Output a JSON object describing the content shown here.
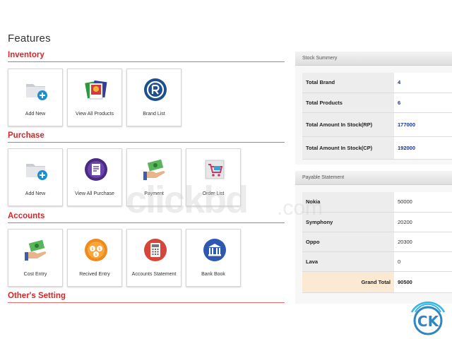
{
  "page": {
    "title": "Features"
  },
  "sections": [
    {
      "title": "Inventory",
      "tiles": [
        {
          "label": "Add New",
          "icon": "folder-add-icon"
        },
        {
          "label": "View All Products",
          "icon": "photos-icon"
        },
        {
          "label": "Brand List",
          "icon": "registered-icon"
        }
      ]
    },
    {
      "title": "Purchase",
      "tiles": [
        {
          "label": "Add New",
          "icon": "folder-add-icon"
        },
        {
          "label": "View All Purchase",
          "icon": "purchase-icon"
        },
        {
          "label": "Payment",
          "icon": "cash-hand-icon"
        },
        {
          "label": "Order List",
          "icon": "cart-icon"
        }
      ]
    },
    {
      "title": "Accounts",
      "tiles": [
        {
          "label": "Cost Entry",
          "icon": "cash-hand-icon"
        },
        {
          "label": "Recived Entry",
          "icon": "coins-icon"
        },
        {
          "label": "Accounts Statement",
          "icon": "calculator-icon"
        },
        {
          "label": "Bank Book",
          "icon": "bank-icon"
        }
      ]
    },
    {
      "title": "Other's Setting",
      "tiles": []
    }
  ],
  "stock_summary": {
    "title": "Stock Summery",
    "rows": [
      {
        "label": "Total Brand",
        "value": "4"
      },
      {
        "label": "Total Products",
        "value": "6"
      },
      {
        "label": "Total Amount In Stock(RP)",
        "value": "177000"
      },
      {
        "label": "Total Amount In Stock(CP)",
        "value": "192000"
      }
    ]
  },
  "payable_statement": {
    "title": "Payable Statement",
    "rows": [
      {
        "label": "Nokia",
        "value": "50000"
      },
      {
        "label": "Symphony",
        "value": "20200"
      },
      {
        "label": "Oppo",
        "value": "20300"
      },
      {
        "label": "Lava",
        "value": "0"
      }
    ],
    "total": {
      "label": "Grand Total",
      "value": "90500"
    }
  },
  "watermark": {
    "text": "clickbd",
    "suffix": ".com",
    "logo_text": "CK"
  },
  "colors": {
    "accent": "#d7262a",
    "link_value": "#1a3399",
    "total_bg": "#fbe9d3"
  }
}
